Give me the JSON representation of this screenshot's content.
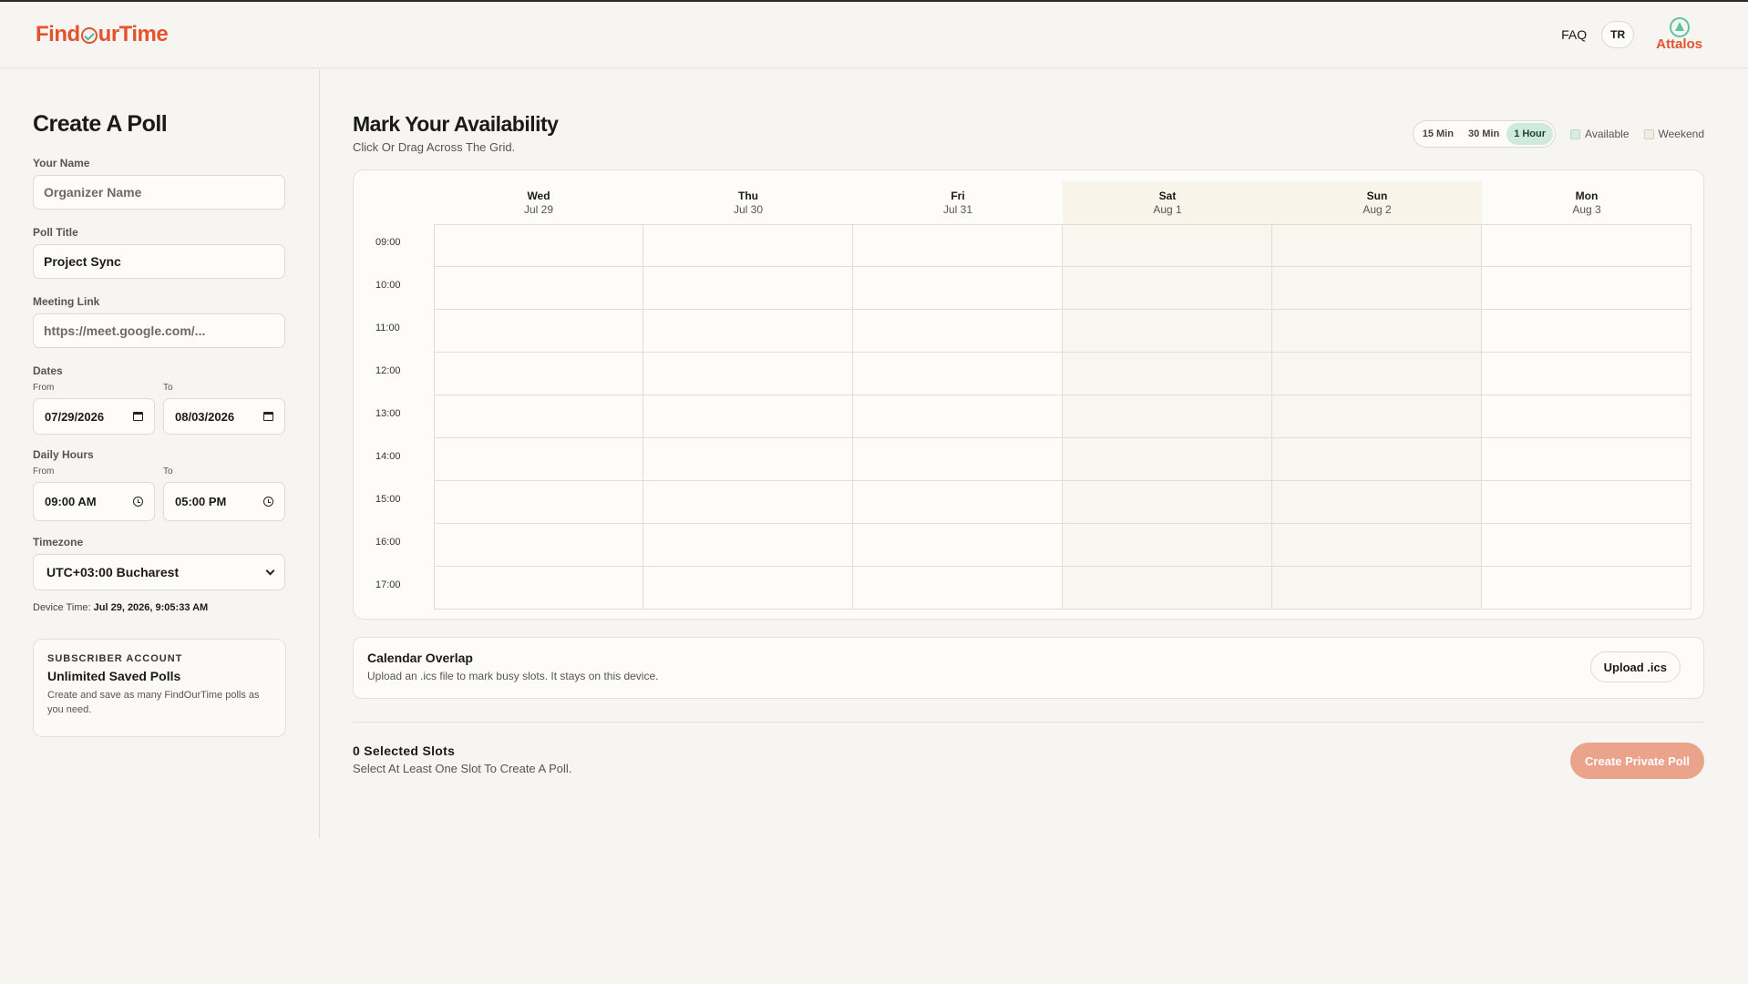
{
  "header": {
    "logo_find": "Find",
    "logo_our": "ur",
    "logo_time": "Time",
    "faq": "FAQ",
    "lang": "TR",
    "partner": "Attalos"
  },
  "sidebar": {
    "title": "Create A Poll",
    "your_name_label": "Your Name",
    "your_name_placeholder": "Organizer Name",
    "poll_title_label": "Poll Title",
    "poll_title_value": "Project Sync",
    "meeting_link_label": "Meeting Link",
    "meeting_link_placeholder": "https://meet.google.com/...",
    "dates_label": "Dates",
    "from_label": "From",
    "to_label": "To",
    "date_from": "07/29/2026",
    "date_to": "08/03/2026",
    "hours_label": "Daily Hours",
    "hours_from": "09:00 AM",
    "hours_to": "05:00 PM",
    "timezone_label": "Timezone",
    "timezone_value": "UTC+03:00 Bucharest",
    "device_time_label": "Device Time:",
    "device_time_value": "Jul 29, 2026, 9:05:33 AM",
    "subscriber": {
      "kicker": "SUBSCRIBER ACCOUNT",
      "title": "Unlimited Saved Polls",
      "desc": "Create and save as many FindOurTime polls as you need."
    }
  },
  "main": {
    "title": "Mark Your Availability",
    "subtitle": "Click Or Drag Across The Grid.",
    "granularity": [
      "15 Min",
      "30 Min",
      "1 Hour"
    ],
    "granularity_selected": "1 Hour",
    "legend_available": "Available",
    "legend_weekend": "Weekend",
    "days": [
      {
        "name": "Wed",
        "date": "Jul 29",
        "weekend": false
      },
      {
        "name": "Thu",
        "date": "Jul 30",
        "weekend": false
      },
      {
        "name": "Fri",
        "date": "Jul 31",
        "weekend": false
      },
      {
        "name": "Sat",
        "date": "Aug 1",
        "weekend": true
      },
      {
        "name": "Sun",
        "date": "Aug 2",
        "weekend": true
      },
      {
        "name": "Mon",
        "date": "Aug 3",
        "weekend": false
      }
    ],
    "hours": [
      "09:00",
      "10:00",
      "11:00",
      "12:00",
      "13:00",
      "14:00",
      "15:00",
      "16:00",
      "17:00"
    ],
    "overlay": {
      "title": "Calendar Overlap",
      "desc": "Upload an .ics file to mark busy slots. It stays on this device.",
      "button": "Upload .ics"
    },
    "selected_count": "0 Selected Slots",
    "selected_hint": "Select At Least One Slot To Create A Poll.",
    "create_button": "Create Private Poll"
  },
  "colors": {
    "brand": "#e4532e",
    "accent": "#4cb79a",
    "create_button_disabled": "#eba38c",
    "active_segment": "#cfe9de"
  }
}
